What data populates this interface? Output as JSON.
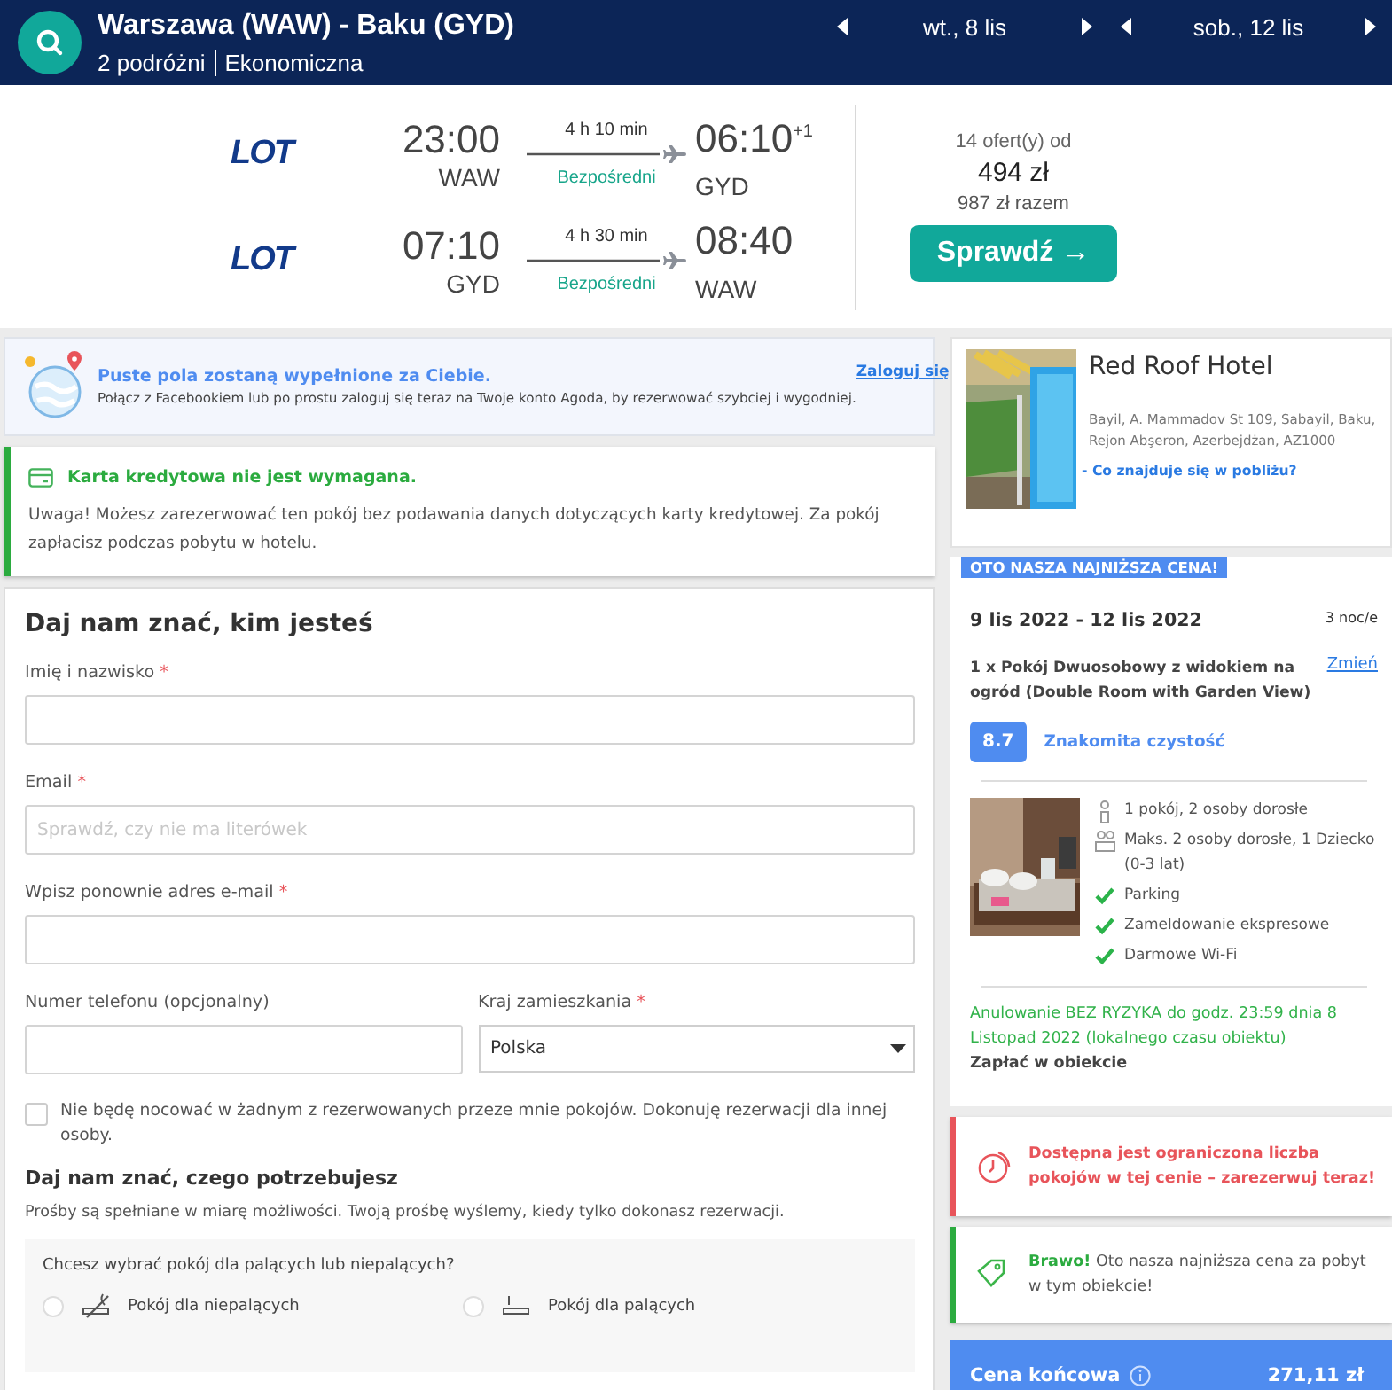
{
  "header": {
    "route": "Warszawa (WAW) - Baku (GYD)",
    "travellers": "2 podróżni",
    "cabin": "Ekonomiczna",
    "dates": [
      {
        "label": "wt., 8 lis"
      },
      {
        "label": "sob., 12 lis"
      }
    ]
  },
  "flights": {
    "legs": [
      {
        "airline_logo": "LOT",
        "depart_time": "23:00",
        "depart_airport": "WAW",
        "duration": "4 h 10 min",
        "stops": "Bezpośredni",
        "arrive_time": "06:10",
        "day_offset": "+1",
        "arrive_airport": "GYD"
      },
      {
        "airline_logo": "LOT",
        "depart_time": "07:10",
        "depart_airport": "GYD",
        "duration": "4 h 30 min",
        "stops": "Bezpośredni",
        "arrive_time": "08:40",
        "arrive_airport": "WAW"
      }
    ],
    "offers": "14 ofert(y) od",
    "price": "494 zł",
    "total": "987 zł razem",
    "button": "Sprawdź →"
  },
  "login_banner": {
    "title": "Puste pola zostaną wypełnione za Ciebie.",
    "text": "Połącz z Facebookiem lub po prostu zaloguj się teraz na Twoje konto Agoda, by rezerwować szybciej i wygodniej.",
    "link": "Zaloguj się"
  },
  "card_notice": {
    "title": "Karta kredytowa nie jest wymagana.",
    "text": "Uwaga! Możesz zarezerwować ten pokój bez podawania danych dotyczących karty kredytowej. Za pokój zapłacisz podczas pobytu w hotelu."
  },
  "guest_form": {
    "heading": "Daj nam znać, kim jesteś",
    "fields": [
      {
        "label": "Imię i nazwisko",
        "required_mark": "*"
      },
      {
        "label": "Email",
        "required_mark": "*",
        "placeholder": "Sprawdź, czy nie ma literówek"
      },
      {
        "label": "Wpisz ponownie adres e-mail",
        "required_mark": "*"
      }
    ],
    "phone": {
      "label": "Numer telefonu (opcjonalny)"
    },
    "country": {
      "label": "Kraj zamieszkania",
      "required_mark": "*",
      "value": "Polska"
    },
    "other_guest": {
      "label": "Nie będę nocować w żadnym z rezerwowanych przeze mnie pokojów. Dokonuję rezerwacji dla innej osoby.",
      "checked": false
    }
  },
  "requests": {
    "heading": "Daj nam znać, czego potrzebujesz",
    "note": "Prośby są spełniane w miarę możliwości. Twoją prośbę wyślemy, kiedy tylko dokonasz rezerwacji.",
    "smoking": {
      "question": "Chcesz wybrać pokój dla palących lub niepalących?",
      "options": [
        {
          "kind": "non-smoking",
          "label": "Pokój dla niepalących",
          "selected": false
        },
        {
          "kind": "smoking",
          "label": "Pokój dla palących",
          "selected": false
        }
      ]
    }
  },
  "hotel": {
    "name": "Red Roof Hotel",
    "address": "Bayil, A. Mammadov St 109, Sabayil, Baku, Rejon Abşeron, Azerbejdżan, AZ1000",
    "nearby_link": "- Co znajduje się w pobliżu?"
  },
  "deal": {
    "badge": "OTO NASZA NAJNIŻSZA CENA!",
    "dates": "9 lis 2022 - 12 lis 2022",
    "nights": "3 noc/e",
    "room": "1 x Pokój Dwuosobowy z widokiem na ogród (Double Room with Garden View)",
    "change_link": "Zmień",
    "score": "8.7",
    "score_label": "Znakomita czystość",
    "features": [
      {
        "kind": "room",
        "text": "1 pokój, 2 osoby dorosłe"
      },
      {
        "kind": "guests",
        "text": "Maks. 2 osoby dorosłe, 1 Dziecko (0-3 lat)"
      },
      {
        "kind": "check",
        "text": "Parking"
      },
      {
        "kind": "check",
        "text": "Zameldowanie ekspresowe"
      },
      {
        "kind": "check",
        "text": "Darmowe Wi-Fi"
      }
    ],
    "cancellation": "Anulowanie BEZ RYZYKA do godz. 23:59 dnia 8 Listopad 2022 (lokalnego czasu obiektu)",
    "payment": "Zapłać w obiekcie"
  },
  "alerts": [
    {
      "kind": "urgent",
      "text": "Dostępna jest ograniczona liczba pokojów w tej cenie – zarezerwuj teraz!"
    },
    {
      "kind": "deal",
      "text": "**Brawo!** Oto nasza najniższa cena za pobyt w tym obiekcie!"
    }
  ],
  "total": {
    "label": "Cena końcowa",
    "price": "271,11 zł"
  }
}
